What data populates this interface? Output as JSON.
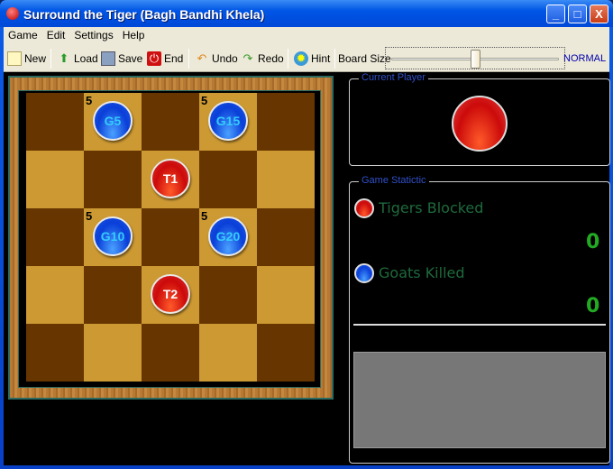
{
  "window": {
    "title": "Surround the Tiger (Bagh Bandhi Khela)",
    "minimize": "_",
    "maximize": "□",
    "close": "X"
  },
  "menu": [
    "Game",
    "Edit",
    "Settings",
    "Help"
  ],
  "toolbar": {
    "new": "New",
    "load": "Load",
    "save": "Save",
    "end": "End",
    "undo": "Undo",
    "redo": "Redo",
    "hint": "Hint",
    "board_size_label": "Board Size",
    "board_size_value": "NORMAL",
    "board_size_slider_fraction": 0.5
  },
  "board": {
    "rows": 5,
    "cols": 5,
    "pieces": [
      {
        "label": "G5",
        "type": "goat",
        "row": 0,
        "col": 1,
        "count": "5"
      },
      {
        "label": "G15",
        "type": "goat",
        "row": 0,
        "col": 3,
        "count": "5"
      },
      {
        "label": "T1",
        "type": "tiger",
        "row": 1,
        "col": 2
      },
      {
        "label": "G10",
        "type": "goat",
        "row": 2,
        "col": 1,
        "count": "5"
      },
      {
        "label": "G20",
        "type": "goat",
        "row": 2,
        "col": 3,
        "count": "5"
      },
      {
        "label": "T2",
        "type": "tiger",
        "row": 3,
        "col": 2
      }
    ]
  },
  "current_player": {
    "legend": "Current Player",
    "player": "tiger"
  },
  "stats": {
    "legend": "Game Statictic",
    "tigers_blocked_label": "Tigers Blocked",
    "tigers_blocked": "0",
    "goats_killed_label": "Goats Killed",
    "goats_killed": "0"
  },
  "colors": {
    "goat": "#1b56e8",
    "tiger": "#cc0a0a",
    "dark_cell": "#673600",
    "light_cell": "#cc9933"
  }
}
